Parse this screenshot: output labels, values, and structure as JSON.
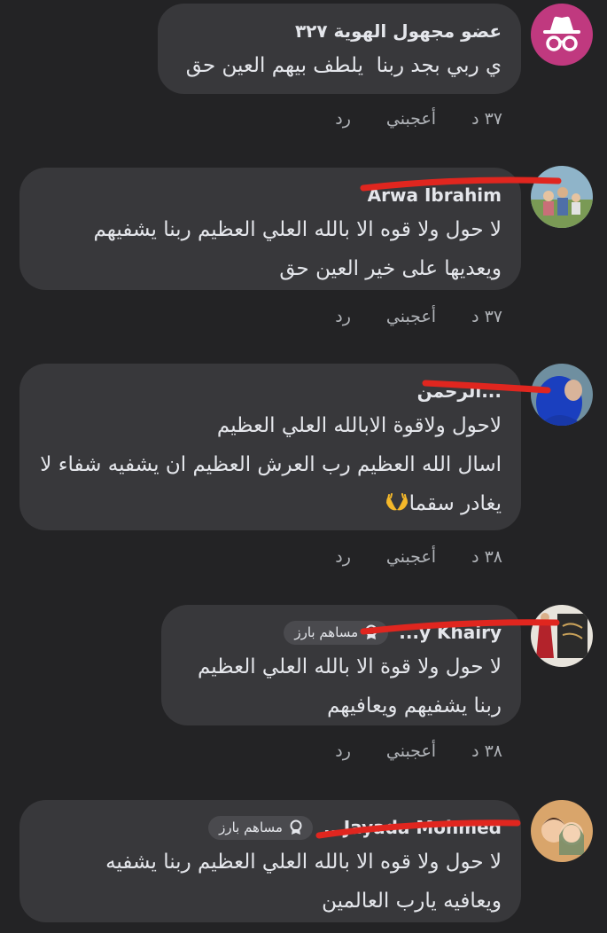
{
  "comments": [
    {
      "name": "عضو مجهول الهوية ٣٢٧",
      "text": "ي ربي بجد ربنا  يلطف بيهم العين حق",
      "time": "٣٧ د",
      "like": "أعجبني",
      "reply": "رد",
      "avatar": "anonymous-member-icon"
    },
    {
      "name": "Arwa Ibrahim",
      "text": "لا حول ولا قوه الا بالله العلي العظيم ربنا يشفيهم\nويعديها على خير العين حق",
      "time": "٣٧ د",
      "like": "أعجبني",
      "reply": "رد",
      "avatar": "family-photo"
    },
    {
      "name": "...الرحمن",
      "text_lines": [
        "لاحول ولاقوة الابالله العلي العظيم",
        "اسال الله العظيم رب العرش العظيم ان يشفيه شفاء لا",
        "يغادر سقما"
      ],
      "emoji": "open-hands-emoji",
      "time": "٣٨ د",
      "like": "أعجبني",
      "reply": "رد",
      "avatar": "blue-hijab-photo"
    },
    {
      "name": "...y Khairy",
      "badge": "مساهم بارز",
      "text": "لا حول ولا قوة الا بالله العلي العظيم\nربنا يشفيهم ويعافيهم",
      "time": "٣٨ د",
      "like": "أعجبني",
      "reply": "رد",
      "avatar": "calligraphy-photo"
    },
    {
      "name": "...Jayada Mohmed",
      "badge": "مساهم بارز",
      "text": "لا حول ولا قوه الا بالله العلي العظيم ربنا يشفيه\nويعافيه يارب العالمين",
      "avatar": "cartoon-couple-photo"
    }
  ],
  "colors": {
    "background": "#232325",
    "bubble": "#38383b",
    "text": "#e4e6eb",
    "secondary": "#b0b3b8",
    "badge": "#4a4a4e",
    "anon_avatar": "#c0397f",
    "redaction": "#e0261f"
  }
}
